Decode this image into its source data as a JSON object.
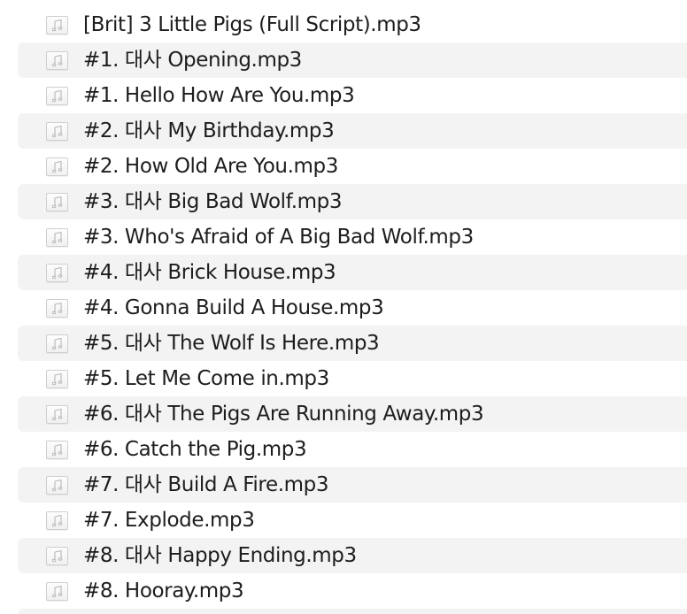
{
  "files": [
    {
      "name": "[Brit] 3 Little Pigs (Full Script).mp3",
      "icon": "music-file-icon"
    },
    {
      "name": "#1. 대사 Opening.mp3",
      "icon": "music-file-icon"
    },
    {
      "name": "#1. Hello How Are You.mp3",
      "icon": "music-file-icon"
    },
    {
      "name": "#2. 대사 My Birthday.mp3",
      "icon": "music-file-icon"
    },
    {
      "name": "#2. How Old Are You.mp3",
      "icon": "music-file-icon"
    },
    {
      "name": "#3. 대사 Big Bad Wolf.mp3",
      "icon": "music-file-icon"
    },
    {
      "name": "#3. Who's Afraid of A Big Bad Wolf.mp3",
      "icon": "music-file-icon"
    },
    {
      "name": "#4. 대사 Brick House.mp3",
      "icon": "music-file-icon"
    },
    {
      "name": "#4. Gonna Build A House.mp3",
      "icon": "music-file-icon"
    },
    {
      "name": "#5. 대사 The Wolf Is Here.mp3",
      "icon": "music-file-icon"
    },
    {
      "name": "#5. Let Me Come in.mp3",
      "icon": "music-file-icon"
    },
    {
      "name": "#6. 대사 The Pigs Are Running Away.mp3",
      "icon": "music-file-icon"
    },
    {
      "name": "#6. Catch the Pig.mp3",
      "icon": "music-file-icon"
    },
    {
      "name": "#7. 대사 Build A Fire.mp3",
      "icon": "music-file-icon"
    },
    {
      "name": "#7. Explode.mp3",
      "icon": "music-file-icon"
    },
    {
      "name": "#8. 대사 Happy Ending.mp3",
      "icon": "music-file-icon"
    },
    {
      "name": "#8. Hooray.mp3",
      "icon": "music-file-icon"
    }
  ],
  "colors": {
    "stripe": "#f3f3f3",
    "text": "#1d1d1f",
    "icon_border": "#cfcfcf",
    "icon_glyph": "#b8b8b8"
  }
}
